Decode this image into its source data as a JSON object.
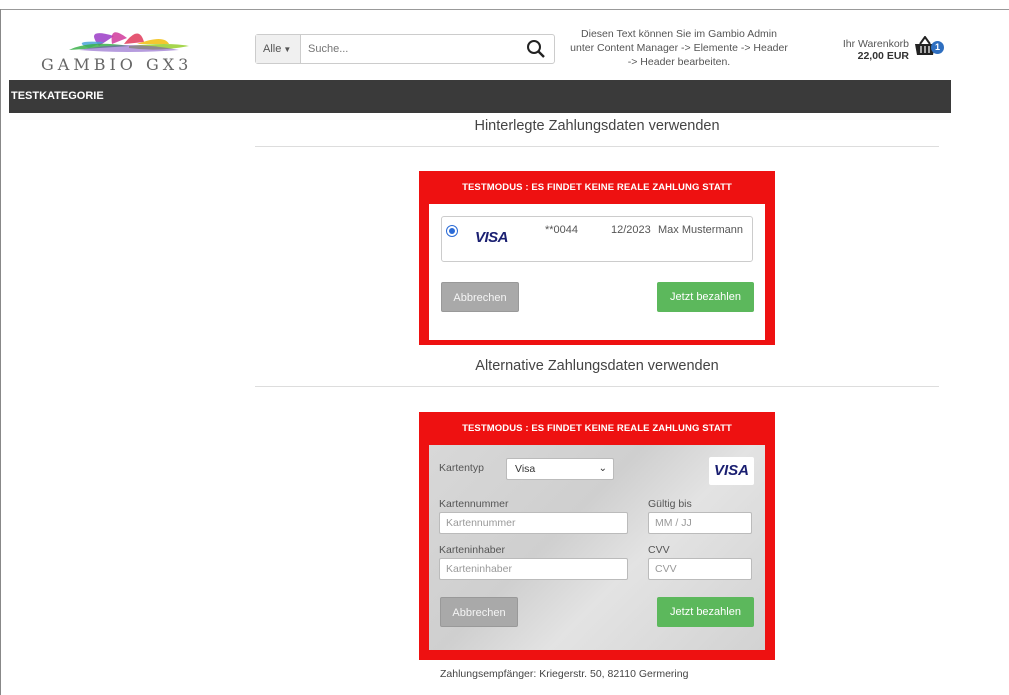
{
  "header": {
    "logo_text": "GAMBIO GX3",
    "search": {
      "category": "Alle",
      "placeholder": "Suche..."
    },
    "admin_note": "Diesen Text können Sie im Gambio Admin unter Content Manager -> Elemente -> Header -> Header bearbeiten.",
    "cart": {
      "label": "Ihr Warenkorb",
      "total": "22,00 EUR",
      "count": "1"
    }
  },
  "nav": {
    "items": [
      {
        "label": "TESTKATEGORIE"
      }
    ]
  },
  "stored": {
    "title": "Hinterlegte Zahlungsdaten verwenden",
    "banner": "TESTMODUS : ES FINDET KEINE REALE ZAHLUNG STATT",
    "card": {
      "brand": "VISA",
      "number": "**0044",
      "expiry": "12/2023",
      "holder": "Max Mustermann"
    },
    "cancel_label": "Abbrechen",
    "pay_label": "Jetzt bezahlen"
  },
  "alternative": {
    "title": "Alternative Zahlungsdaten verwenden",
    "banner": "TESTMODUS : ES FINDET KEINE REALE ZAHLUNG STATT",
    "card_type_label": "Kartentyp",
    "card_type_value": "Visa",
    "brand": "VISA",
    "card_number_label": "Kartennummer",
    "card_number_placeholder": "Kartennummer",
    "valid_label": "Gültig bis",
    "valid_placeholder": "MM / JJ",
    "holder_label": "Karteninhaber",
    "holder_placeholder": "Karteninhaber",
    "cvv_label": "CVV",
    "cvv_placeholder": "CVV",
    "cancel_label": "Abbrechen",
    "pay_label": "Jetzt bezahlen"
  },
  "footer": {
    "recipient": "Zahlungsempfänger: Kriegerstr. 50, 82110 Germering"
  },
  "colors": {
    "banner_red": "#ee1111",
    "nav_bg": "#3a3a3a",
    "pay_green": "#5cb85c",
    "link_blue": "#2f6fc0"
  }
}
